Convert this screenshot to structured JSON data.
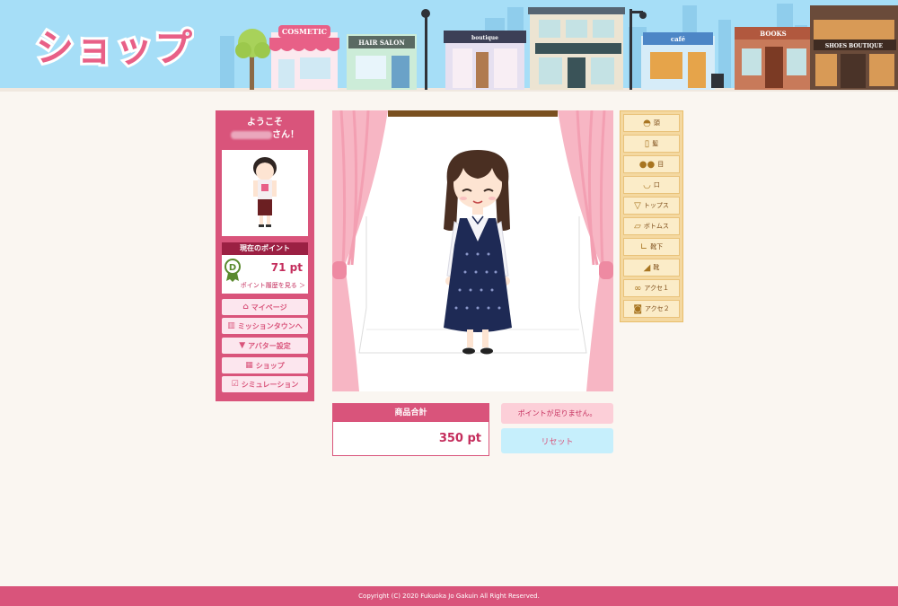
{
  "header": {
    "logo_text": "ショップ",
    "signs": {
      "cosmetic": "COSMETIC",
      "hair_salon": "HAIR SALON",
      "boutique": "boutique",
      "cafe": "café",
      "books": "BOOKS",
      "shoes": "SHOES BOUTIQUE"
    }
  },
  "sidebar": {
    "welcome_line1": "ようこそ",
    "welcome_suffix": "さん！",
    "points_label": "現在のポイント",
    "points_value": "71 pt",
    "points_history_link": "ポイント履歴を見る ＞",
    "nav": [
      {
        "label": "マイページ",
        "icon": "home-icon"
      },
      {
        "label": "ミッションタウンへ",
        "icon": "building-icon"
      },
      {
        "label": "アバター設定",
        "icon": "tshirt-icon"
      },
      {
        "label": "ショップ",
        "icon": "shop-icon"
      },
      {
        "label": "シミュレーション",
        "icon": "checklist-icon"
      }
    ]
  },
  "total": {
    "label": "商品合計",
    "value": "350 pt"
  },
  "warning": "ポイントが足りません。",
  "reset_label": "リセット",
  "categories": [
    {
      "label": "頭",
      "icon": "hat-icon"
    },
    {
      "label": "髪",
      "icon": "hair-icon"
    },
    {
      "label": "目",
      "icon": "eyes-icon"
    },
    {
      "label": "口",
      "icon": "mouth-icon"
    },
    {
      "label": "トップス",
      "icon": "tops-icon"
    },
    {
      "label": "ボトムス",
      "icon": "bottoms-icon"
    },
    {
      "label": "靴下",
      "icon": "socks-icon"
    },
    {
      "label": "靴",
      "icon": "shoe-icon"
    },
    {
      "label": "アクセ１",
      "icon": "glasses-icon"
    },
    {
      "label": "アクセ２",
      "icon": "bag-icon"
    }
  ],
  "footer": "Copyright (C) 2020 Fukuoka Jo Gakuin All Right Reserved.",
  "colors": {
    "primary": "#d9547b",
    "dark": "#9b2043",
    "sky": "#a6def7",
    "panel": "#f4d8a0",
    "reset": "#c6effc"
  }
}
